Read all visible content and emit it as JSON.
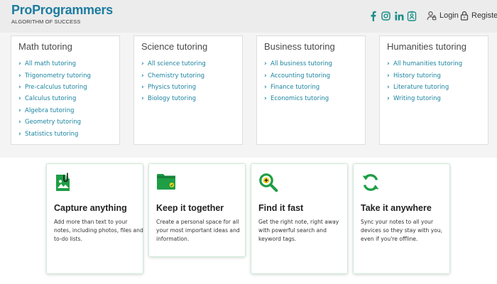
{
  "brand": {
    "name": "ProProgrammers",
    "tagline": "ALGORITHM OF SUCCESS",
    "primary_color": "#1c7ca0",
    "accent_color": "#1a8f86"
  },
  "header": {
    "social_icons": [
      "facebook-icon",
      "instagram-icon",
      "linkedin-icon",
      "share-icon"
    ],
    "login_label": "Login",
    "register_label": "Register"
  },
  "tutoring": [
    {
      "title": "Math tutoring",
      "links": [
        "All math tutoring",
        "Trigonometry tutoring",
        "Pre-calculus tutoring",
        "Calculus tutoring",
        "Algebra tutoring",
        "Geometry tutoring",
        "Statistics tutoring"
      ]
    },
    {
      "title": "Science tutoring",
      "links": [
        "All science tutoring",
        "Chemistry tutoring",
        "Physics tutoring",
        "Biology tutoring"
      ]
    },
    {
      "title": "Business tutoring",
      "links": [
        "All business tutoring",
        "Accounting tutoring",
        "Finance tutoring",
        "Economics tutoring"
      ]
    },
    {
      "title": "Humanities tutoring",
      "links": [
        "All humanities tutoring",
        "History tutoring",
        "Literature tutoring",
        "Writing tutoring"
      ]
    }
  ],
  "features": [
    {
      "icon": "attachment-image-icon",
      "title": "Capture anything",
      "description": "Add more than text to your notes, including photos, files and to-do lists."
    },
    {
      "icon": "folder-check-icon",
      "title": "Keep it together",
      "description": "Create a personal space for all your most important ideas and information."
    },
    {
      "icon": "search-plus-icon",
      "title": "Find it fast",
      "description": "Get the right note, right away with powerful search and keyword tags."
    },
    {
      "icon": "sync-icon",
      "title": "Take it anywhere",
      "description": "Sync your notes to all your devices so they stay with you, even if you're offline."
    }
  ]
}
